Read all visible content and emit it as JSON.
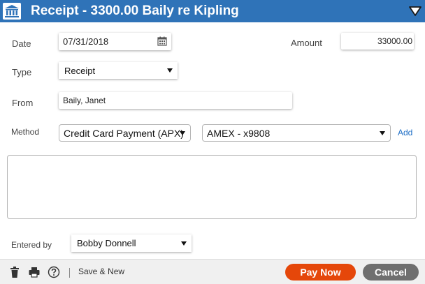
{
  "header": {
    "title": "Receipt - 3300.00 Baily re Kipling",
    "icon": "bank-icon",
    "collapse_icon": "triangle-down-icon",
    "color": "#2f73b8"
  },
  "form": {
    "date_label": "Date",
    "date_value": "07/31/2018",
    "amount_label": "Amount",
    "amount_value": "33000.00",
    "type_label": "Type",
    "type_value": "Receipt",
    "from_label": "From",
    "from_value": "Baily, Janet",
    "method_label": "Method",
    "method_value": "Credit Card Payment (APX)",
    "card_value": "AMEX - x9808",
    "add_label": "Add",
    "memo_value": "",
    "entered_by_label": "Entered by",
    "entered_by_value": "Bobby Donnell"
  },
  "footer": {
    "save_new_label": "Save & New",
    "pay_now_label": "Pay Now",
    "cancel_label": "Cancel",
    "pay_color": "#e5470a",
    "cancel_color": "#6f6f6f"
  }
}
